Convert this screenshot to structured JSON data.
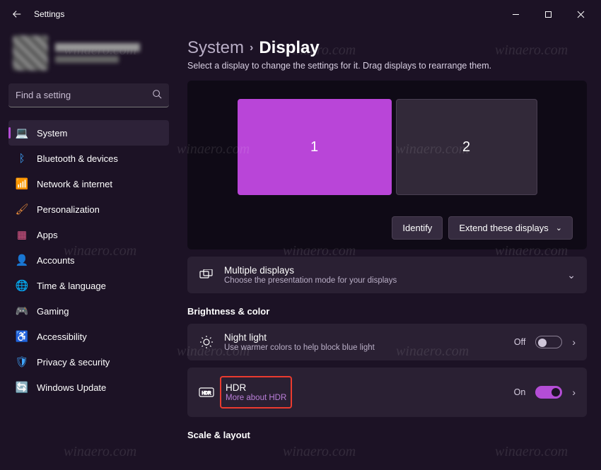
{
  "window": {
    "title": "Settings"
  },
  "search": {
    "placeholder": "Find a setting"
  },
  "nav": {
    "items": [
      {
        "label": "System"
      },
      {
        "label": "Bluetooth & devices"
      },
      {
        "label": "Network & internet"
      },
      {
        "label": "Personalization"
      },
      {
        "label": "Apps"
      },
      {
        "label": "Accounts"
      },
      {
        "label": "Time & language"
      },
      {
        "label": "Gaming"
      },
      {
        "label": "Accessibility"
      },
      {
        "label": "Privacy & security"
      },
      {
        "label": "Windows Update"
      }
    ]
  },
  "breadcrumb": {
    "parent": "System",
    "current": "Display"
  },
  "page": {
    "subtitle": "Select a display to change the settings for it. Drag displays to rearrange them.",
    "monitor1": "1",
    "monitor2": "2",
    "identify": "Identify",
    "extend": "Extend these displays",
    "multipleDisplays": {
      "title": "Multiple displays",
      "desc": "Choose the presentation mode for your displays"
    },
    "brightnessHeader": "Brightness & color",
    "nightLight": {
      "title": "Night light",
      "desc": "Use warmer colors to help block blue light",
      "state": "Off"
    },
    "hdr": {
      "title": "HDR",
      "desc": "More about HDR",
      "state": "On"
    },
    "scaleHeader": "Scale & layout"
  }
}
